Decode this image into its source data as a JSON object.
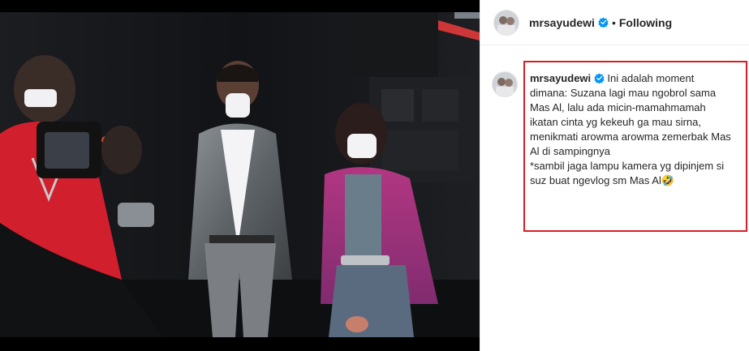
{
  "post": {
    "username": "mrsayudewi",
    "separator": "•",
    "follow_status": "Following",
    "caption": {
      "username": "mrsayudewi",
      "text": "Ini adalah moment dimana: Suzana lagi mau ngobrol sama Mas Al, lalu ada micin-mamahmamah ikatan cinta yg kekeuh ga mau sirna, menikmati arowma arowma zemerbak Mas Al di sampingnya\n*sambil jaga lampu kamera yg dipinjem si suz buat ngevlog sm Mas Al🤣"
    }
  },
  "icons": {
    "verified": "verified-badge-icon",
    "avatar": "profile-avatar"
  },
  "colors": {
    "highlight_border": "#d61e25",
    "verified_blue": "#0095f6",
    "text": "#262626",
    "photo_background": "#0a0b0c"
  }
}
